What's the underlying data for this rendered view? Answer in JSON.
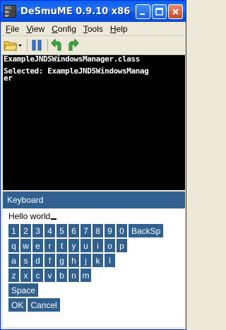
{
  "window": {
    "title": "DeSmuME 0.9.10 x86",
    "icon_text": "DES MU ME"
  },
  "menu": [
    {
      "label": "File",
      "mnemonic": "F",
      "rest": "ile"
    },
    {
      "label": "View",
      "mnemonic": "V",
      "rest": "iew"
    },
    {
      "label": "Config",
      "mnemonic": "C",
      "rest": "onfig"
    },
    {
      "label": "Tools",
      "mnemonic": "T",
      "rest": "ools"
    },
    {
      "label": "Help",
      "mnemonic": "H",
      "rest": "elp"
    }
  ],
  "toolbar": {
    "icons": [
      "open-rom-icon",
      "dropdown-arrow-icon",
      "pause-icon",
      "undo-icon",
      "redo-icon"
    ]
  },
  "top_screen": {
    "line1": "ExampleJNDSWindowsManager.class",
    "line2": "Selected: ExampleJNDSWindowsManag",
    "line3": "er"
  },
  "keyboard": {
    "title": "Keyboard",
    "text": "Hello world",
    "row1": [
      "1",
      "2",
      "3",
      "4",
      "5",
      "6",
      "7",
      "8",
      "9",
      "0",
      "BackSp"
    ],
    "row2": [
      "q",
      "w",
      "e",
      "r",
      "t",
      "y",
      "u",
      "i",
      "o",
      "p"
    ],
    "row3": [
      "a",
      "s",
      "d",
      "f",
      "g",
      "h",
      "j",
      "k",
      "l"
    ],
    "row4": [
      "z",
      "x",
      "c",
      "v",
      "b",
      "n",
      "m"
    ],
    "space": "Space",
    "ok": "OK",
    "cancel": "Cancel"
  },
  "colors": {
    "key_bg": "#31608f",
    "titlebar": "#0a5ef4"
  }
}
